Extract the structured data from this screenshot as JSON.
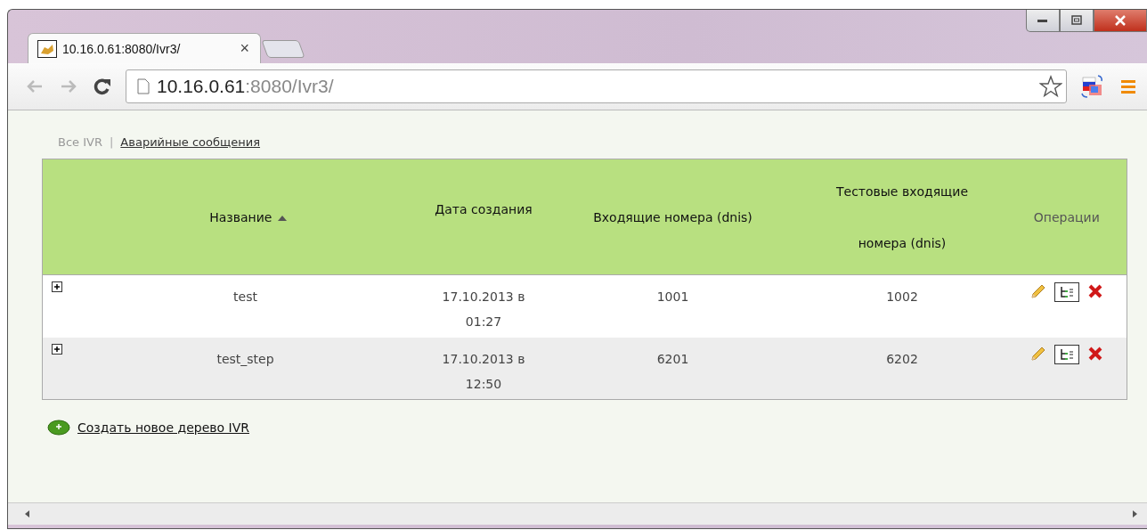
{
  "tabs": [
    {
      "title": "10.16.0.61:8080/Ivr3/",
      "close": "×",
      "selected": true
    }
  ],
  "address_bar": {
    "host": "10.16.0.61",
    "rest": ":8080/Ivr3/"
  },
  "nav_links": [
    {
      "label": "Все IVR",
      "selected": true
    },
    {
      "label": "Аварийные сообщения",
      "selected": false
    }
  ],
  "nav_separator": "|",
  "table": {
    "columns": [
      {
        "label": "Название",
        "sorted_ascending": true,
        "kind": "name"
      },
      {
        "label": "Дата создания",
        "kind": "date"
      },
      {
        "label": "Входящие номера (dnis)",
        "kind": "dnis"
      },
      {
        "label": "Тестовые входящие номера (dnis)",
        "kind": "test"
      },
      {
        "label": "Операции",
        "kind": "ops"
      }
    ],
    "rows": [
      {
        "expanded": false,
        "name": "test",
        "date": "17.10.2013 в 01:27",
        "dnis": "1001",
        "test_dnis": "1002"
      },
      {
        "expanded": false,
        "name": "test_step",
        "date": "17.10.2013 в 12:50",
        "dnis": "6201",
        "test_dnis": "6202"
      }
    ]
  },
  "create_link": "Создать новое дерево IVR"
}
